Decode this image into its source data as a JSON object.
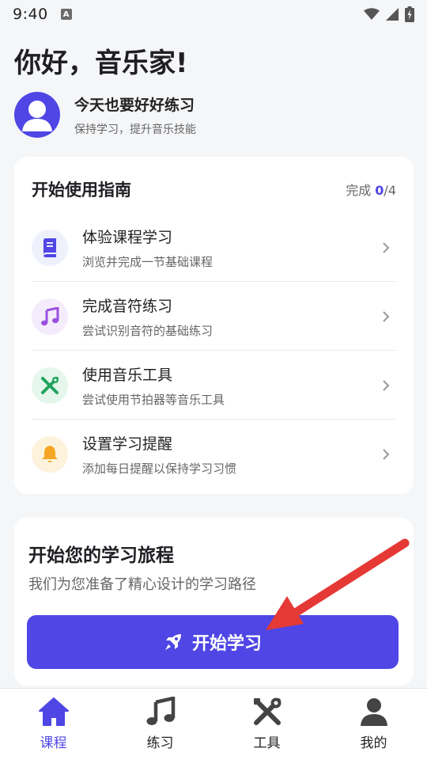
{
  "status_bar": {
    "time": "9:40",
    "notification_letter": "A"
  },
  "header": {
    "greeting": "你好，音乐家!",
    "profile_title": "今天也要好好练习",
    "profile_subtitle": "保持学习，提升音乐技能"
  },
  "guide": {
    "title": "开始使用指南",
    "progress_prefix": "完成 ",
    "progress_done": "0",
    "progress_total": "/4",
    "items": [
      {
        "title": "体验课程学习",
        "subtitle": "浏览并完成一节基础课程",
        "icon": "book-icon",
        "color": "#4f46e5",
        "bg": "#eef0fb"
      },
      {
        "title": "完成音符练习",
        "subtitle": "尝试识别音符的基础练习",
        "icon": "music-note-icon",
        "color": "#9b51e0",
        "bg": "#f4ecfc"
      },
      {
        "title": "使用音乐工具",
        "subtitle": "尝试使用节拍器等音乐工具",
        "icon": "tools-icon",
        "color": "#22a45d",
        "bg": "#e5f7ec"
      },
      {
        "title": "设置学习提醒",
        "subtitle": "添加每日提醒以保持学习习惯",
        "icon": "bell-icon",
        "color": "#f5a623",
        "bg": "#fdf3dc"
      }
    ]
  },
  "journey": {
    "title": "开始您的学习旅程",
    "subtitle": "我们为您准备了精心设计的学习路径",
    "button_label": "开始学习",
    "button_icon": "rocket-icon"
  },
  "bottom_nav": [
    {
      "label": "课程",
      "icon": "home-icon",
      "active": true
    },
    {
      "label": "练习",
      "icon": "music-note-icon",
      "active": false
    },
    {
      "label": "工具",
      "icon": "tools-icon",
      "active": false
    },
    {
      "label": "我的",
      "icon": "user-icon",
      "active": false
    }
  ],
  "colors": {
    "accent": "#4f46e5",
    "annotation_arrow": "#e53935"
  }
}
